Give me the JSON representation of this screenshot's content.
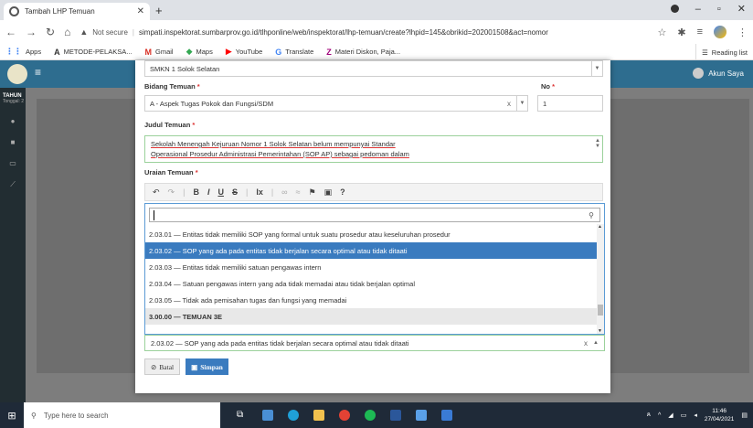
{
  "browser": {
    "tab_title": "Tambah LHP Temuan",
    "url_prefix": "Not secure",
    "url": "simpati.inspektorat.sumbarprov.go.id/tlhponline/web/inspektorat/lhp-temuan/create?lhpid=145&obrikid=20200150​8&act=nomor",
    "reading_list": "Reading list"
  },
  "bookmarks": [
    {
      "label": "Apps",
      "icon": "apps-grid-icon"
    },
    {
      "label": "METODE-PELAKSA...",
      "icon": "a-icon"
    },
    {
      "label": "Gmail",
      "icon": "gmail-icon"
    },
    {
      "label": "Maps",
      "icon": "maps-icon"
    },
    {
      "label": "YouTube",
      "icon": "youtube-icon"
    },
    {
      "label": "Translate",
      "icon": "translate-icon"
    },
    {
      "label": "Materi Diskon, Paja...",
      "icon": "z-icon"
    }
  ],
  "appbar": {
    "user": "Akun Saya"
  },
  "sidebar": {
    "tahun": "TAHUN",
    "tanggal": "Tonggal: 2"
  },
  "form": {
    "obrik_value": "SMKN 1 Solok Selatan",
    "bidang_label": "Bidang Temuan",
    "bidang_value": "A - Aspek Tugas Pokok dan Fungsi/SDM",
    "no_label": "No",
    "no_value": "1",
    "judul_label": "Judul Temuan",
    "judul_line1": "Sekolah Menengah Kejuruan Nomor 1 Solok Selatan belum mempunyai Standar",
    "judul_line2": "Operasional Prosedur Administrasi Pemerintahan (SOP AP) sebagai pedoman dalam",
    "uraian_label": "Uraian Temuan",
    "selected_value": "2.03.02 — SOP yang ada pada entitas tidak berjalan secara optimal atau tidak ditaati",
    "cancel": "Batal",
    "save": "Simpan"
  },
  "dropdown_options": [
    {
      "text": "2.03.01 — Entitas tidak memiliki SOP yang formal untuk suatu prosedur atau keseluruhan prosedur",
      "state": "normal"
    },
    {
      "text": "2.03.02 — SOP yang ada pada entitas tidak berjalan secara optimal atau tidak ditaati",
      "state": "selected"
    },
    {
      "text": "2.03.03 — Entitas tidak memiliki satuan pengawas intern",
      "state": "normal"
    },
    {
      "text": "2.03.04 — Satuan pengawas intern yang ada tidak memadai atau tidak berjalan optimal",
      "state": "normal"
    },
    {
      "text": "2.03.05 — Tidak ada pemisahan tugas dan fungsi yang memadai",
      "state": "normal"
    },
    {
      "text": "3.00.00 — TEMUAN 3E",
      "state": "group"
    }
  ],
  "taskbar": {
    "search": "Type here to search",
    "time": "11:46",
    "date": "27/04/2021"
  }
}
